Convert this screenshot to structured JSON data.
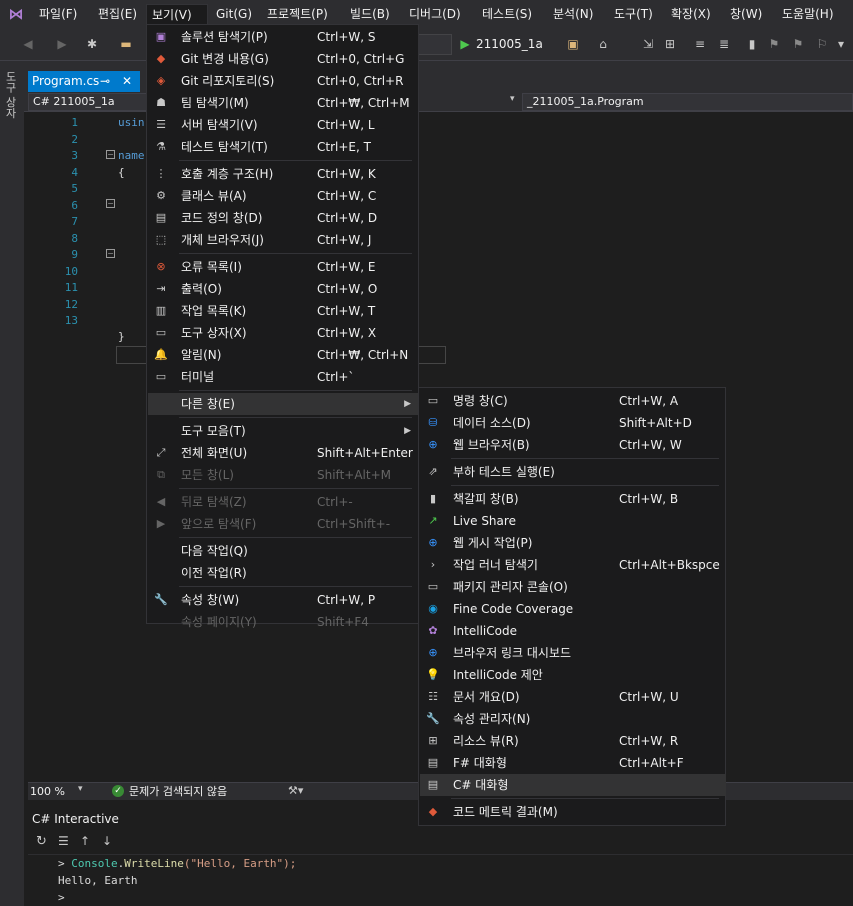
{
  "menubar": {
    "items": [
      "파일(F)",
      "편집(E)",
      "보기(V)",
      "Git(G)",
      "프로젝트(P)",
      "빌드(B)",
      "디버그(D)",
      "테스트(S)",
      "분석(N)",
      "도구(T)",
      "확장(X)",
      "창(W)",
      "도움말(H)"
    ]
  },
  "toolbar": {
    "run_label": "211005_1a"
  },
  "sidebar": {
    "label": "도구 상자"
  },
  "tabs": {
    "doc_tab": "Program.cs"
  },
  "nav": {
    "project": "C# 211005_1a",
    "class": "_211005_1a.Program"
  },
  "editor": {
    "line_numbers": [
      "1",
      "2",
      "3",
      "4",
      "5",
      "6",
      "7",
      "8",
      "9",
      "10",
      "11",
      "12",
      "13"
    ],
    "code_using": "usin",
    "code_namespace": "name",
    "brace_open": "{",
    "brace_close": "}"
  },
  "view_menu": {
    "items": [
      {
        "label": "솔루션 탐색기(P)",
        "shortcut": "Ctrl+W, S",
        "icon": "solution-explorer-icon"
      },
      {
        "label": "Git 변경 내용(G)",
        "shortcut": "Ctrl+0, Ctrl+G",
        "icon": "git-changes-icon"
      },
      {
        "label": "Git 리포지토리(S)",
        "shortcut": "Ctrl+0, Ctrl+R",
        "icon": "git-repository-icon"
      },
      {
        "label": "팀 탐색기(M)",
        "shortcut": "Ctrl+₩, Ctrl+M",
        "icon": "team-explorer-icon"
      },
      {
        "label": "서버 탐색기(V)",
        "shortcut": "Ctrl+W, L",
        "icon": "server-explorer-icon"
      },
      {
        "label": "테스트 탐색기(T)",
        "shortcut": "Ctrl+E, T",
        "icon": "test-explorer-icon"
      },
      {
        "label": "호출 계층 구조(H)",
        "shortcut": "Ctrl+W, K",
        "icon": "call-hierarchy-icon"
      },
      {
        "label": "클래스 뷰(A)",
        "shortcut": "Ctrl+W, C",
        "icon": "class-view-icon"
      },
      {
        "label": "코드 정의 창(D)",
        "shortcut": "Ctrl+W, D",
        "icon": "code-definition-icon"
      },
      {
        "label": "개체 브라우저(J)",
        "shortcut": "Ctrl+W, J",
        "icon": "object-browser-icon"
      },
      {
        "label": "오류 목록(I)",
        "shortcut": "Ctrl+W, E",
        "icon": "error-list-icon"
      },
      {
        "label": "출력(O)",
        "shortcut": "Ctrl+W, O",
        "icon": "output-icon"
      },
      {
        "label": "작업 목록(K)",
        "shortcut": "Ctrl+W, T",
        "icon": "task-list-icon"
      },
      {
        "label": "도구 상자(X)",
        "shortcut": "Ctrl+W, X",
        "icon": "toolbox-icon"
      },
      {
        "label": "알림(N)",
        "shortcut": "Ctrl+₩, Ctrl+N",
        "icon": "bell-icon"
      },
      {
        "label": "터미널",
        "shortcut": "Ctrl+`",
        "icon": "terminal-icon"
      },
      {
        "label": "다른 창(E)",
        "shortcut": "",
        "icon": ""
      },
      {
        "label": "도구 모음(T)",
        "shortcut": "",
        "icon": ""
      },
      {
        "label": "전체 화면(U)",
        "shortcut": "Shift+Alt+Enter",
        "icon": "fullscreen-icon"
      },
      {
        "label": "모든 창(L)",
        "shortcut": "Shift+Alt+M",
        "icon": "all-windows-icon"
      },
      {
        "label": "뒤로 탐색(Z)",
        "shortcut": "Ctrl+-",
        "icon": "back-icon"
      },
      {
        "label": "앞으로 탐색(F)",
        "shortcut": "Ctrl+Shift+-",
        "icon": "forward-icon"
      },
      {
        "label": "다음 작업(Q)",
        "shortcut": "",
        "icon": ""
      },
      {
        "label": "이전 작업(R)",
        "shortcut": "",
        "icon": ""
      },
      {
        "label": "속성 창(W)",
        "shortcut": "Ctrl+W, P",
        "icon": "wrench-icon"
      },
      {
        "label": "속성 페이지(Y)",
        "shortcut": "Shift+F4",
        "icon": ""
      }
    ]
  },
  "other_windows_menu": {
    "items": [
      {
        "label": "명령 창(C)",
        "shortcut": "Ctrl+W, A",
        "icon": "command-window-icon"
      },
      {
        "label": "데이터 소스(D)",
        "shortcut": "Shift+Alt+D",
        "icon": "data-sources-icon"
      },
      {
        "label": "웹 브라우저(B)",
        "shortcut": "Ctrl+W, W",
        "icon": "web-browser-icon"
      },
      {
        "label": "부하 테스트 실행(E)",
        "shortcut": "",
        "icon": "load-test-icon"
      },
      {
        "label": "책갈피 창(B)",
        "shortcut": "Ctrl+W, B",
        "icon": "bookmark-window-icon"
      },
      {
        "label": "Live Share",
        "shortcut": "",
        "icon": "live-share-icon"
      },
      {
        "label": "웹 게시 작업(P)",
        "shortcut": "",
        "icon": "web-publish-icon"
      },
      {
        "label": "작업 러너 탐색기",
        "shortcut": "Ctrl+Alt+Bkspce",
        "icon": "task-runner-icon"
      },
      {
        "label": "패키지 관리자 콘솔(O)",
        "shortcut": "",
        "icon": "package-console-icon"
      },
      {
        "label": "Fine Code Coverage",
        "shortcut": "",
        "icon": "code-coverage-icon"
      },
      {
        "label": "IntelliCode",
        "shortcut": "",
        "icon": "intellicode-icon"
      },
      {
        "label": "브라우저 링크 대시보드",
        "shortcut": "",
        "icon": "browser-link-icon"
      },
      {
        "label": "IntelliCode 제안",
        "shortcut": "",
        "icon": "lightbulb-icon"
      },
      {
        "label": "문서 개요(D)",
        "shortcut": "Ctrl+W, U",
        "icon": "document-outline-icon"
      },
      {
        "label": "속성 관리자(N)",
        "shortcut": "",
        "icon": "property-manager-icon"
      },
      {
        "label": "리소스 뷰(R)",
        "shortcut": "Ctrl+W, R",
        "icon": "resource-view-icon"
      },
      {
        "label": "F# 대화형",
        "shortcut": "Ctrl+Alt+F",
        "icon": "fsharp-interactive-icon"
      },
      {
        "label": "C# 대화형",
        "shortcut": "",
        "icon": "csharp-interactive-icon"
      },
      {
        "label": "코드 메트릭 결과(M)",
        "shortcut": "",
        "icon": "code-metrics-icon"
      }
    ]
  },
  "status": {
    "zoom": "100 %",
    "issues": "문제가 검색되지 않음"
  },
  "interactive": {
    "title": "C# Interactive",
    "prompt": ">",
    "console": "Console",
    "dot": ".",
    "writeline": "WriteLine",
    "args": "(\"Hello, Earth\");",
    "output": "Hello, Earth"
  }
}
